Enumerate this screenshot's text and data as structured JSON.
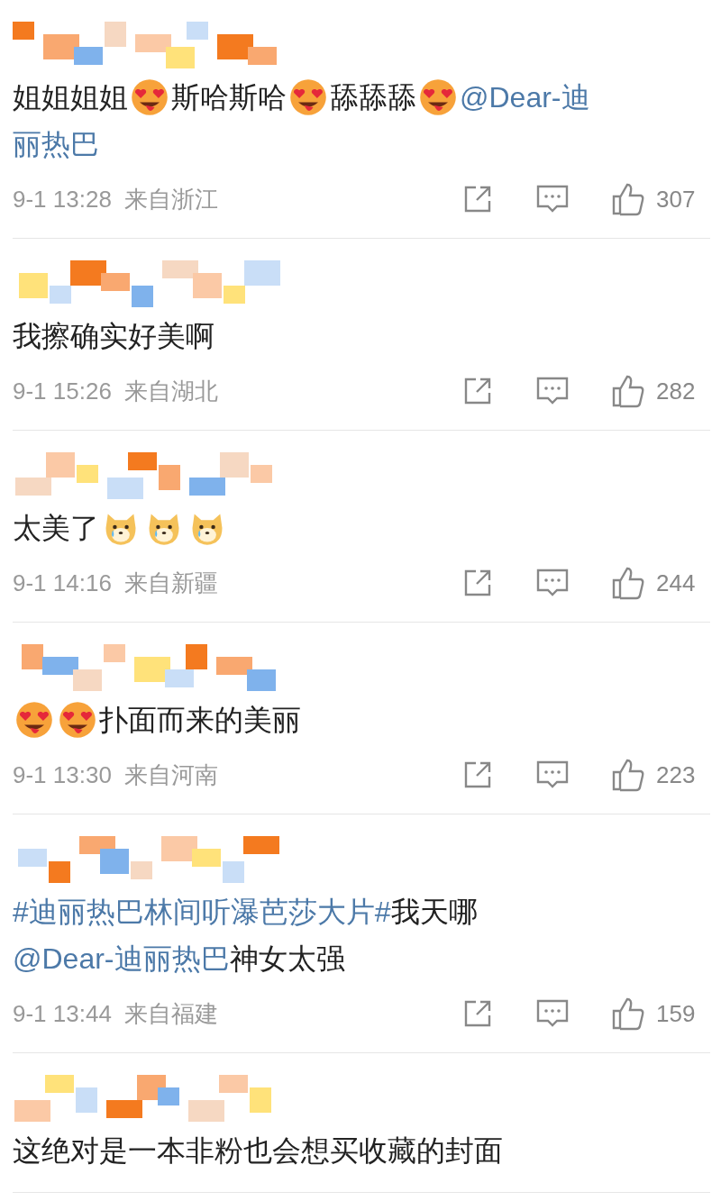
{
  "comments": [
    {
      "lines": [
        [
          {
            "kind": "text",
            "text": "姐姐姐姐"
          },
          {
            "kind": "hearteyes"
          },
          {
            "kind": "text",
            "text": "斯哈斯哈"
          },
          {
            "kind": "hearteyes"
          },
          {
            "kind": "text",
            "text": "舔舔舔"
          },
          {
            "kind": "hearteyes"
          },
          {
            "kind": "link",
            "text": "@Dear-迪"
          }
        ],
        [
          {
            "kind": "link",
            "text": "丽热巴"
          }
        ]
      ],
      "time": "9-1 13:28",
      "location": "来自浙江",
      "likes": "307"
    },
    {
      "lines": [
        [
          {
            "kind": "text",
            "text": "我擦确实好美啊"
          }
        ]
      ],
      "time": "9-1 15:26",
      "location": "来自湖北",
      "likes": "282"
    },
    {
      "lines": [
        [
          {
            "kind": "text",
            "text": "太美了"
          },
          {
            "kind": "cryingdog"
          },
          {
            "kind": "cryingdog"
          },
          {
            "kind": "cryingdog"
          }
        ]
      ],
      "time": "9-1 14:16",
      "location": "来自新疆",
      "likes": "244"
    },
    {
      "lines": [
        [
          {
            "kind": "hearteyes"
          },
          {
            "kind": "hearteyes"
          },
          {
            "kind": "text",
            "text": "扑面而来的美丽"
          }
        ]
      ],
      "time": "9-1 13:30",
      "location": "来自河南",
      "likes": "223"
    },
    {
      "lines": [
        [
          {
            "kind": "link",
            "text": "#迪丽热巴林间听瀑芭莎大片#"
          },
          {
            "kind": "text",
            "text": " 我天哪"
          }
        ],
        [
          {
            "kind": "link",
            "text": "@Dear-迪丽热巴"
          },
          {
            "kind": "text",
            "text": " 神女太强"
          }
        ]
      ],
      "time": "9-1 13:44",
      "location": "来自福建",
      "likes": "159"
    },
    {
      "lines": [
        [
          {
            "kind": "text",
            "text": "这绝对是一本非粉也会想买收藏的封面"
          }
        ]
      ]
    }
  ]
}
